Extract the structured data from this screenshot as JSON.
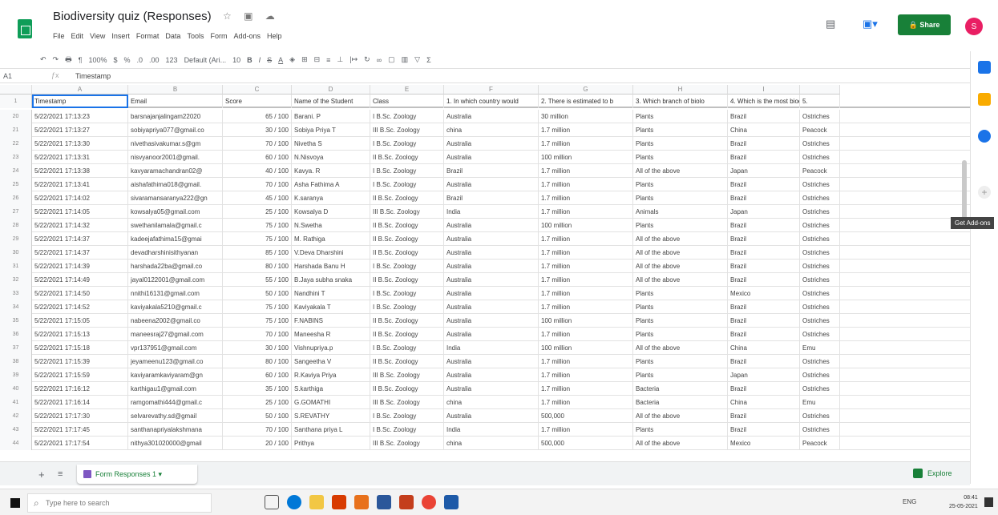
{
  "title": "Biodiversity quiz (Responses)",
  "menu": [
    "File",
    "Edit",
    "View",
    "Insert",
    "Format",
    "Data",
    "Tools",
    "Form",
    "Add-ons",
    "Help"
  ],
  "share_label": "Share",
  "avatar_initial": "S",
  "toolbar": {
    "zoom": "100%",
    "currency": "$",
    "percent": "%",
    "dec1": ".0",
    "dec2": ".00",
    "format": "123",
    "font": "Default (Ari...",
    "size": "10"
  },
  "formula": {
    "cell": "A1",
    "value": "Timestamp"
  },
  "col_letters": [
    "A",
    "B",
    "C",
    "D",
    "E",
    "F",
    "G",
    "H",
    "I",
    ""
  ],
  "headers": [
    "Timestamp",
    "Email",
    "Score",
    "Name of the Student",
    "Class",
    "1. In which country would",
    "2. There is estimated to b",
    "3. Which branch of biolo",
    "4. Which is the most biod",
    "5."
  ],
  "rows": [
    {
      "n": "20",
      "cells": [
        "5/22/2021 17:13:23",
        "barsnajanjalingam22020",
        "65 / 100",
        "Barani. P",
        "I B.Sc. Zoology",
        "Australia",
        "30 million",
        "Plants",
        "Brazil",
        "Ostriches"
      ]
    },
    {
      "n": "21",
      "cells": [
        "5/22/2021 17:13:27",
        "sobiyapriya077@gmail.co",
        "30 / 100",
        "Sobiya Priya T",
        "III B.Sc. Zoology",
        "china",
        "1.7 million",
        "Plants",
        "China",
        "Peacock"
      ]
    },
    {
      "n": "22",
      "cells": [
        "5/22/2021 17:13:30",
        "nivethasivakumar.s@gm",
        "70 / 100",
        "Nivetha S",
        "I B.Sc. Zoology",
        "Australia",
        "1.7 million",
        "Plants",
        "Brazil",
        "Ostriches"
      ]
    },
    {
      "n": "23",
      "cells": [
        "5/22/2021 17:13:31",
        "nisvyanoor2001@gmail.",
        "60 / 100",
        "N.Nisvoya",
        "II B.Sc. Zoology",
        "Australia",
        "100 million",
        "Plants",
        "Brazil",
        "Ostriches"
      ]
    },
    {
      "n": "24",
      "cells": [
        "5/22/2021 17:13:38",
        "kavyaramachandran02@",
        "40 / 100",
        "Kavya. R",
        "I B.Sc. Zoology",
        "Brazil",
        "1.7 million",
        "All of the above",
        "Japan",
        "Peacock"
      ]
    },
    {
      "n": "25",
      "cells": [
        "5/22/2021 17:13:41",
        "aishafathima018@gmail.",
        "70 / 100",
        "Asha Fathima A",
        "I B.Sc. Zoology",
        "Australia",
        "1.7 million",
        "Plants",
        "Brazil",
        "Ostriches"
      ]
    },
    {
      "n": "26",
      "cells": [
        "5/22/2021 17:14:02",
        "sivaramansaranya222@gn",
        "45 / 100",
        "K.saranya",
        "II B.Sc. Zoology",
        "Brazil",
        "1.7 million",
        "Plants",
        "Brazil",
        "Ostriches"
      ]
    },
    {
      "n": "27",
      "cells": [
        "5/22/2021 17:14:05",
        "kowsalya05@gmail.com",
        "25 / 100",
        "Kowsalya D",
        "III B.Sc. Zoology",
        "India",
        "1.7 million",
        "Animals",
        "Japan",
        "Ostriches"
      ]
    },
    {
      "n": "28",
      "cells": [
        "5/22/2021 17:14:32",
        "swethanilamala@gmail.c",
        "75 / 100",
        "N.Swetha",
        "II B.Sc. Zoology",
        "Australia",
        "100 million",
        "Plants",
        "Brazil",
        "Ostriches"
      ]
    },
    {
      "n": "29",
      "cells": [
        "5/22/2021 17:14:37",
        "kadeejafathima15@gmai",
        "75 / 100",
        "M. Rathiga",
        "II B.Sc. Zoology",
        "Australia",
        "1.7 million",
        "All of the above",
        "Brazil",
        "Ostriches"
      ]
    },
    {
      "n": "30",
      "cells": [
        "5/22/2021 17:14:37",
        "devadharshinisithyanan",
        "85 / 100",
        "V.Deva Dharshini",
        "II B.Sc. Zoology",
        "Australia",
        "1.7 million",
        "All of the above",
        "Brazil",
        "Ostriches"
      ]
    },
    {
      "n": "31",
      "cells": [
        "5/22/2021 17:14:39",
        "harshada22ba@gmail.co",
        "80 / 100",
        "Harshada Banu H",
        "I B.Sc. Zoology",
        "Australia",
        "1.7 million",
        "All of the above",
        "Brazil",
        "Ostriches"
      ]
    },
    {
      "n": "32",
      "cells": [
        "5/22/2021 17:14:49",
        "jayal0122001@gmail.com",
        "55 / 100",
        "B.Jaya subha snaka",
        "II B.Sc. Zoology",
        "Australia",
        "1.7 million",
        "All of the above",
        "Brazil",
        "Ostriches"
      ]
    },
    {
      "n": "33",
      "cells": [
        "5/22/2021 17:14:50",
        "nnithi16131@gmail.com",
        "50 / 100",
        "Nandhini T",
        "I B.Sc. Zoology",
        "Australia",
        "1.7 million",
        "Plants",
        "Mexico",
        "Ostriches"
      ]
    },
    {
      "n": "34",
      "cells": [
        "5/22/2021 17:14:52",
        "kaviyakala5210@gmail.c",
        "75 / 100",
        "Kaviyakala T",
        "I B.Sc. Zoology",
        "Australia",
        "1.7 million",
        "Plants",
        "Brazil",
        "Ostriches"
      ]
    },
    {
      "n": "35",
      "cells": [
        "5/22/2021 17:15:05",
        "nabeena2002@gmail.co",
        "75 / 100",
        "F.NABINS",
        "II B.Sc. Zoology",
        "Australia",
        "100 million",
        "Plants",
        "Brazil",
        "Ostriches"
      ]
    },
    {
      "n": "36",
      "cells": [
        "5/22/2021 17:15:13",
        "maneesraj27@gmail.com",
        "70 / 100",
        "Maneesha R",
        "II B.Sc. Zoology",
        "Australia",
        "1.7 million",
        "Plants",
        "Brazil",
        "Ostriches"
      ]
    },
    {
      "n": "37",
      "cells": [
        "5/22/2021 17:15:18",
        "vpr137951@gmail.com",
        "30 / 100",
        "Vishnupriya.p",
        "I B.Sc. Zoology",
        "India",
        "100 million",
        "All of the above",
        "China",
        "Emu"
      ]
    },
    {
      "n": "38",
      "cells": [
        "5/22/2021 17:15:39",
        "jeyameenu123@gmail.co",
        "80 / 100",
        "Sangeetha V",
        "II B.Sc. Zoology",
        "Australia",
        "1.7 million",
        "Plants",
        "Brazil",
        "Ostriches"
      ]
    },
    {
      "n": "39",
      "cells": [
        "5/22/2021 17:15:59",
        "kaviyaramkaviyaram@gn",
        "60 / 100",
        "R.Kaviya Priya",
        "III B.Sc. Zoology",
        "Australia",
        "1.7 million",
        "Plants",
        "Japan",
        "Ostriches"
      ]
    },
    {
      "n": "40",
      "cells": [
        "5/22/2021 17:16:12",
        "karthigau1@gmail.com",
        "35 / 100",
        "S.karthiga",
        "II B.Sc. Zoology",
        "Australia",
        "1.7 million",
        "Bacteria",
        "Brazil",
        "Ostriches"
      ]
    },
    {
      "n": "41",
      "cells": [
        "5/22/2021 17:16:14",
        "ramgomathi444@gmail.c",
        "25 / 100",
        "G.GOMATHI",
        "III B.Sc. Zoology",
        "china",
        "1.7 million",
        "Bacteria",
        "China",
        "Emu"
      ]
    },
    {
      "n": "42",
      "cells": [
        "5/22/2021 17:17:30",
        "selvarevathy.sd@gmail",
        "50 / 100",
        "S.REVATHY",
        "I B.Sc. Zoology",
        "Australia",
        "500,000",
        "All of the above",
        "Brazil",
        "Ostriches"
      ]
    },
    {
      "n": "43",
      "cells": [
        "5/22/2021 17:17:45",
        "santhanapriyalakshmana",
        "70 / 100",
        "Santhana priya L",
        "I B.Sc. Zoology",
        "India",
        "1.7 million",
        "Plants",
        "Brazil",
        "Ostriches"
      ]
    },
    {
      "n": "44",
      "cells": [
        "5/22/2021 17:17:54",
        "nithya301020000@gmail",
        "20 / 100",
        "Prithya",
        "III B.Sc. Zoology",
        "china",
        "500,000",
        "All of the above",
        "Mexico",
        "Peacock"
      ]
    }
  ],
  "tooltip": "Get Add-ons",
  "sheet_tab": "Form Responses 1",
  "explore": "Explore",
  "search_placeholder": "Type here to search",
  "tray": {
    "lang": "ENG",
    "time": "08:41",
    "date": "25-05-2021"
  }
}
